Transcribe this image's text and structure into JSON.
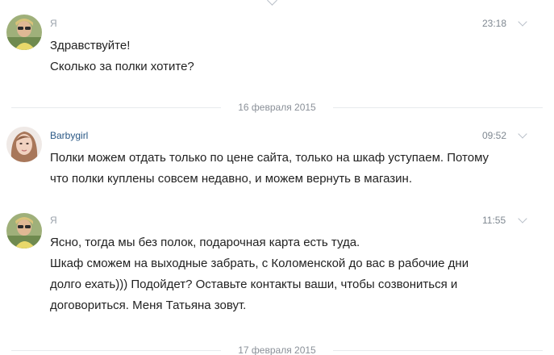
{
  "messages": [
    {
      "author": "Я",
      "time": "23:18",
      "lines": [
        "Здравствуйте!",
        "Сколько за полки хотите?"
      ]
    },
    {
      "author": "Barbygirl",
      "time": "09:52",
      "lines": [
        "Полки можем отдать только по цене сайта, только на шкаф уступаем. Потому что полки куплены совсем недавно, и можем вернуть в магазин."
      ]
    },
    {
      "author": "Я",
      "time": "11:55",
      "lines": [
        "Ясно, тогда мы без полок, подарочная карта есть туда.",
        "Шкаф сможем на выходные забрать, с Коломенской до вас в рабочие дни долго ехать))) Подойдет? Оставьте контакты ваши, чтобы созвониться и договориться. Меня Татьяна зовут."
      ]
    }
  ],
  "date_separators": [
    "16 февраля 2015",
    "17 февраля 2015"
  ],
  "icons": {
    "avatar_self": "avatar-photo-sunglasses",
    "avatar_other": "avatar-photo-woman",
    "message_menu": "chevron-down-icon"
  }
}
